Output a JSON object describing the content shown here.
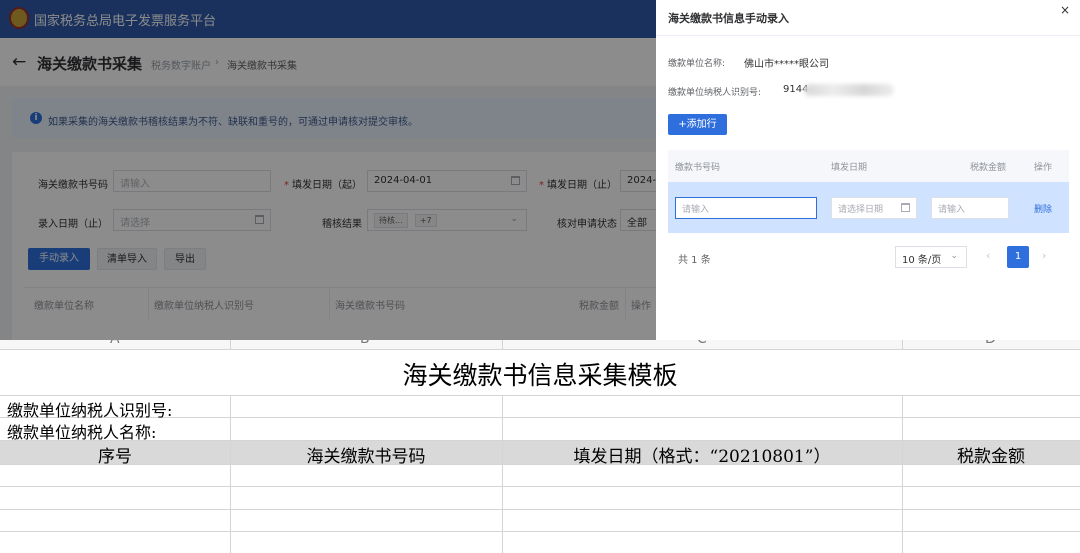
{
  "app": {
    "platform_title": "国家税务总局电子发票服务平台",
    "page_title": "海关缴款书采集",
    "breadcrumb": [
      "税务数字账户",
      "海关缴款书采集"
    ],
    "breadcrumb_separator": "›",
    "notice": "如果采集的海关缴款书稽核结果为不符、缺联和重号的，可通过申请核对提交审核。",
    "filters": {
      "customs_no_label": "海关缴款书号码",
      "customs_no_placeholder": "请输入",
      "issue_date_from_label": "填发日期（起）",
      "issue_date_from_value": "2024-04-01",
      "issue_date_to_label": "填发日期（止）",
      "issue_date_to_value": "2024-",
      "entry_date_to_label": "录入日期（止）",
      "entry_date_to_placeholder": "请选择",
      "check_result_label": "稽核结果",
      "check_result_tag": "待核...",
      "check_result_more": "+7",
      "check_apply_status_label": "核对申请状态",
      "check_apply_status_value": "全部"
    },
    "buttons": {
      "manual_entry": "手动录入",
      "list_import": "清单导入",
      "export": "导出"
    },
    "table_headers": [
      "缴款单位名称",
      "缴款单位纳税人识别号",
      "海关缴款书号码",
      "税款金额",
      "操作"
    ]
  },
  "drawer": {
    "title": "海关缴款书信息手动录入",
    "close": "×",
    "payer_name_label": "缴款单位名称:",
    "payer_name_value": "佛山市*****眼公司",
    "payer_tin_label": "缴款单位纳税人识别号:",
    "payer_tin_value": "9144",
    "add_row": "+添加行",
    "columns": [
      "缴款书号码",
      "填发日期",
      "税款金额",
      "操作"
    ],
    "row": {
      "no_placeholder": "请输入",
      "date_placeholder": "请选择日期",
      "amount_placeholder": "请输入",
      "delete": "删除"
    },
    "total": "共 1 条",
    "page_size": "10 条/页",
    "current_page": "1",
    "prev": "‹",
    "next": "›"
  },
  "sheet": {
    "column_letters": [
      "A",
      "B",
      "C",
      "D"
    ],
    "title": "海关缴款书信息采集模板",
    "tin_label": "缴款单位纳税人识别号:",
    "name_label": "缴款单位纳税人名称:",
    "headers": [
      "序号",
      "海关缴款书号码",
      "填发日期（格式：“20210801”）",
      "税款金额"
    ]
  },
  "colors": {
    "brand_blue": "#2f5aa8",
    "primary_button": "#2f6fdd",
    "selected_row": "#cfe2ff",
    "sheet_header_fill": "#d9d9d9"
  }
}
